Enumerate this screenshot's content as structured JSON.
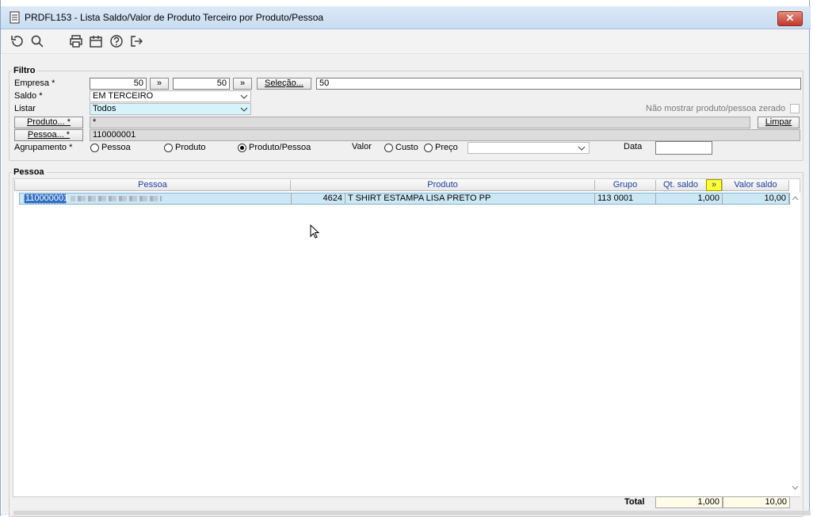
{
  "window": {
    "title": "PRDFL153 - Lista Saldo/Valor de Produto Terceiro por Produto/Pessoa",
    "close_label": "✕"
  },
  "filtro": {
    "group_label": "Filtro",
    "empresa_label": "Empresa *",
    "empresa_from": "50",
    "empresa_to": "50",
    "range_btn": "»",
    "selecao_btn": "Seleção...",
    "selecao_value": "50",
    "saldo_label": "Saldo *",
    "saldo_value": "EM TERCEIRO",
    "listar_label": "Listar",
    "listar_value": "Todos",
    "nao_mostrar_label": "Não mostrar produto/pessoa zerado",
    "produto_btn": "Produto... *",
    "produto_value": "*",
    "limpar_btn": "Limpar",
    "pessoa_btn": "Pessoa... *",
    "pessoa_value": "110000001",
    "agrupamento_label": "Agrupamento *",
    "opt_pessoa": "Pessoa",
    "opt_produto": "Produto",
    "opt_produto_pessoa": "Produto/Pessoa",
    "valor_label": "Valor",
    "opt_custo": "Custo",
    "opt_preco": "Preço",
    "valor_select": "",
    "data_label": "Data",
    "data_value": ""
  },
  "pessoa_grid": {
    "group_label": "Pessoa",
    "columns": [
      "Pessoa",
      "Produto",
      "Grupo",
      "Qt. saldo",
      "Valor saldo"
    ],
    "expand_btn": "»",
    "rows": [
      {
        "pessoa_code": "110000001",
        "produto_code": "4624",
        "produto_desc": "T SHIRT ESTAMPA LISA PRETO PP",
        "grupo": "113 0001",
        "qt_saldo": "1,000",
        "valor_saldo": "10,00"
      }
    ],
    "total_label": "Total",
    "total_qt": "1,000",
    "total_valor": "10,00"
  }
}
